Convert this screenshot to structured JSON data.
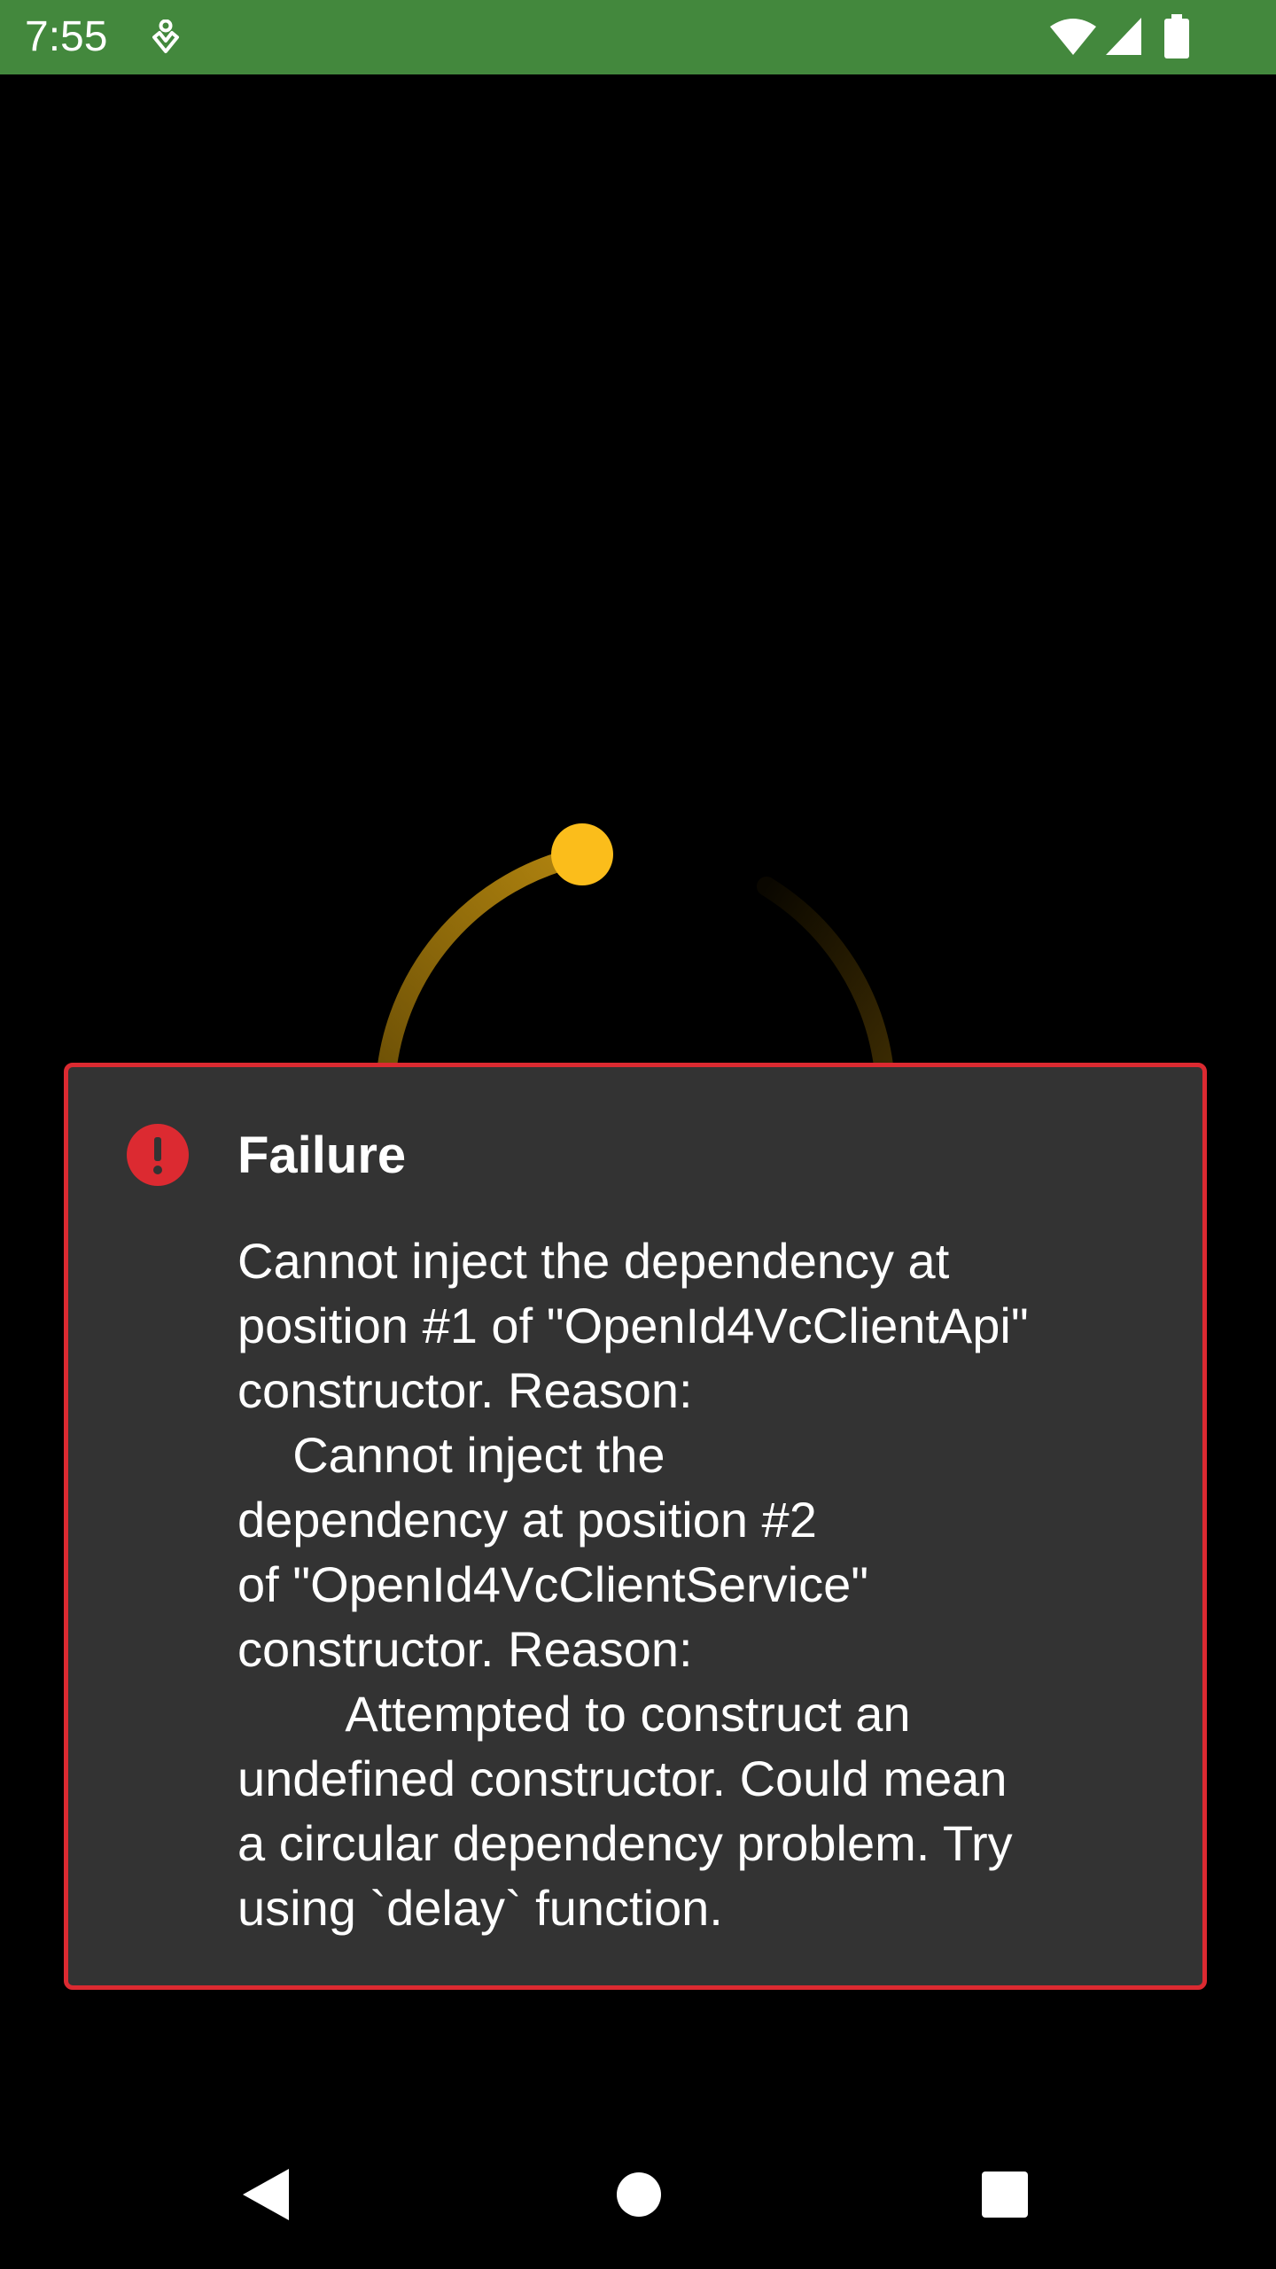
{
  "status_bar": {
    "time": "7:55",
    "background_color": "#43883d",
    "icons": [
      "accessibility-icon",
      "wifi-icon",
      "signal-icon",
      "battery-icon"
    ]
  },
  "loading_spinner": {
    "accent_color": "#fbbd1b",
    "icon": "loading-spinner-icon"
  },
  "dialog": {
    "title": "Failure",
    "icon": "error-icon",
    "border_color": "#dc2a31",
    "message": "Cannot inject the dependency at\nposition #1 of \"OpenId4VcClientApi\"\nconstructor. Reason:\n    Cannot inject the\ndependency at position #2\nof \"OpenId4VcClientService\"\nconstructor. Reason:\n        Attempted to construct an\nundefined constructor. Could mean\na circular dependency problem. Try\nusing `delay` function."
  },
  "navigation_bar": {
    "buttons": [
      "back-icon",
      "home-icon",
      "recents-icon"
    ]
  }
}
